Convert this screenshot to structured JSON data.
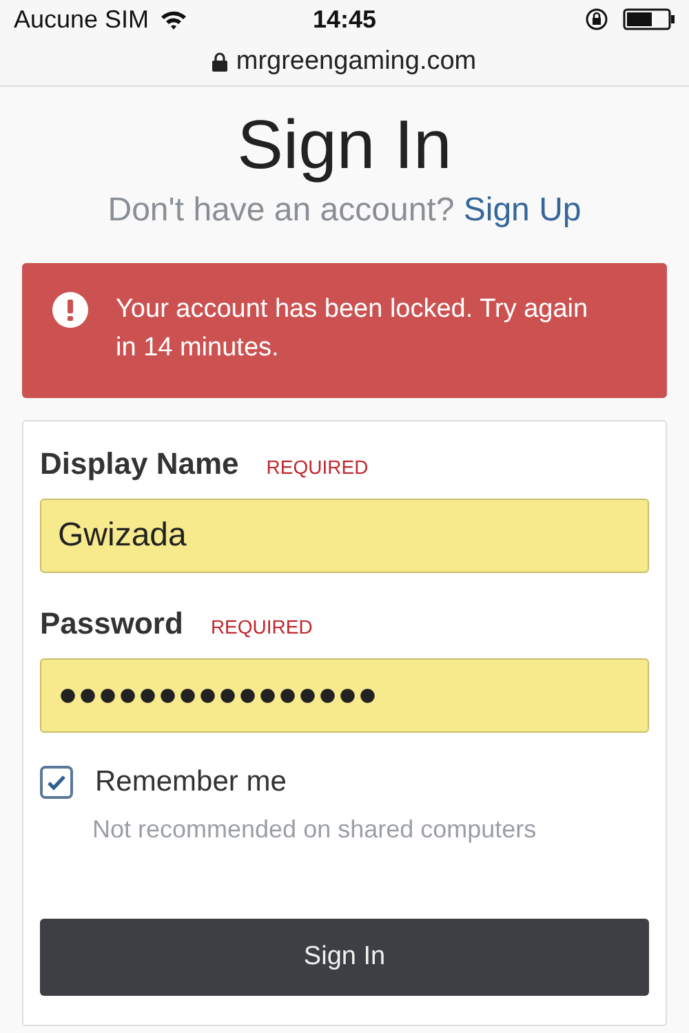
{
  "status_bar": {
    "carrier": "Aucune SIM",
    "time": "14:45"
  },
  "address_bar": {
    "url": "mrgreengaming.com"
  },
  "title": "Sign In",
  "subtitle": {
    "text": "Don't have an account?",
    "link": "Sign Up"
  },
  "alert": {
    "message": "Your account has been locked. Try again in 14 minutes."
  },
  "fields": [
    {
      "label": "Display Name",
      "badge": "REQUIRED",
      "value": "Gwizada"
    },
    {
      "label": "Password",
      "badge": "REQUIRED",
      "value": "●●●●●●●●●●●●●●●●"
    }
  ],
  "remember": {
    "label": "Remember me",
    "hint": "Not recommended on shared computers",
    "checked": true
  },
  "submit": "Sign In"
}
